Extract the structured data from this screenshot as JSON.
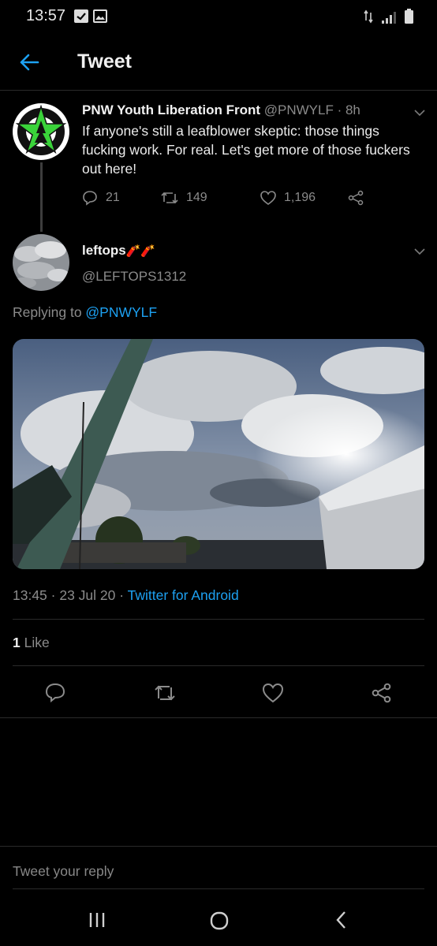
{
  "status_bar": {
    "time": "13:57",
    "left_icons": [
      "checkbox-icon",
      "gallery-icon"
    ],
    "right_icons": [
      "data-arrows-icon",
      "signal-icon",
      "battery-icon"
    ]
  },
  "header": {
    "title": "Tweet",
    "back_icon": "arrow-left-icon",
    "accent": "#1da1f2"
  },
  "original_tweet": {
    "author_name": "PNW Youth Liberation Front",
    "handle": "@PNWYLF",
    "separator": " · ",
    "age": "8h",
    "text": "If anyone's still a leafblower skeptic: those things fucking work. For real. Let's get more of those fuckers out here!",
    "reply_count": "21",
    "retweet_count": "149",
    "like_count": "1,196"
  },
  "reply_tweet": {
    "author_name": "leftops",
    "name_emoji": "🧨🧨",
    "handle": "@LEFTOPS1312",
    "replying_prefix": "Replying to ",
    "replying_to": "@PNWYLF",
    "time": "13:45",
    "date": "23 Jul 20",
    "meta_sep": " · ",
    "source": "Twitter for Android",
    "like_count": "1",
    "like_label": " Like"
  },
  "reply_box": {
    "placeholder": "Tweet your reply"
  },
  "nav_bar": {
    "icons": [
      "recents-icon",
      "home-icon",
      "back-icon"
    ]
  }
}
